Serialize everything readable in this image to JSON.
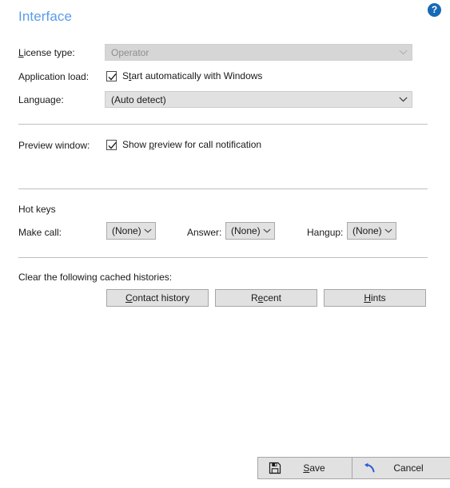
{
  "page": {
    "title": "Interface",
    "title_color": "#5a9bea",
    "help_icon": "?",
    "help_icon_name": "help-question-icon"
  },
  "form": {
    "license": {
      "label_pre": "",
      "label_acc": "L",
      "label_post": "icense type:",
      "label_full": "License type:",
      "value": "Operator",
      "disabled": true
    },
    "application_load": {
      "label": "Application load:",
      "checkbox_pre": "S",
      "checkbox_acc": "t",
      "checkbox_post": "art automatically with Windows",
      "checkbox_label_full": "Start automatically with Windows",
      "checked": true
    },
    "language": {
      "label": "Language:",
      "value": "(Auto detect)",
      "disabled": false
    },
    "preview_window": {
      "label": "Preview window:",
      "checkbox_pre": "Show ",
      "checkbox_acc": "p",
      "checkbox_post": "review for call notification",
      "checkbox_label_full": "Show preview for call notification",
      "checked": true
    }
  },
  "hotkeys": {
    "heading": "Hot keys",
    "items": [
      {
        "label": "Make call:",
        "value": "(None)"
      },
      {
        "label": "Answer:",
        "value": "(None)"
      },
      {
        "label": "Hangup:",
        "value": "(None)"
      }
    ]
  },
  "cache": {
    "heading": "Clear the following cached histories:",
    "buttons": [
      {
        "pre": "",
        "acc": "C",
        "post": "ontact history",
        "full": "Contact history"
      },
      {
        "pre": "R",
        "acc": "e",
        "post": "cent",
        "full": "Recent"
      },
      {
        "pre": "",
        "acc": "H",
        "post": "ints",
        "full": "Hints"
      }
    ]
  },
  "footer": {
    "save": {
      "pre": "",
      "acc": "S",
      "post": "ave",
      "full": "Save",
      "icon": "floppy-disk-icon"
    },
    "cancel": {
      "pre": "",
      "acc": "",
      "post": "Cancel",
      "full": "Cancel",
      "icon": "undo-arrow-icon",
      "icon_color": "#2a5cd7"
    }
  }
}
